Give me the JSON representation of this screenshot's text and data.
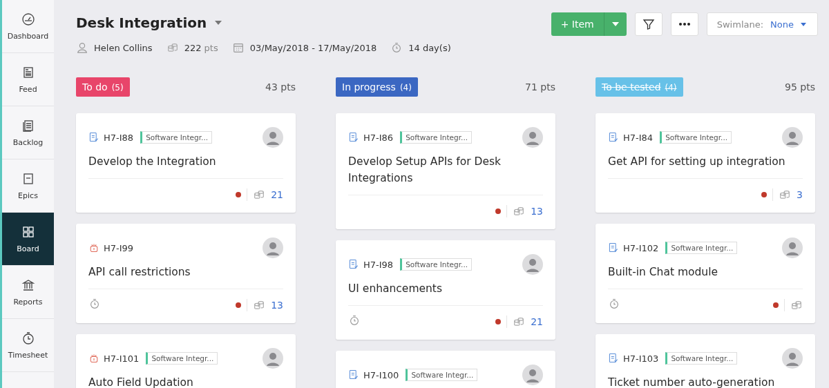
{
  "sidebar": {
    "items": [
      {
        "label": "Dashboard",
        "selected": false
      },
      {
        "label": "Feed",
        "selected": false
      },
      {
        "label": "Backlog",
        "selected": false
      },
      {
        "label": "Epics",
        "selected": false
      },
      {
        "label": "Board",
        "selected": true
      },
      {
        "label": "Reports",
        "selected": false
      },
      {
        "label": "Timesheet",
        "selected": false
      }
    ]
  },
  "header": {
    "title": "Desk Integration",
    "owner": "Helen Collins",
    "points": "222",
    "points_unit": "pts",
    "date_range": "03/May/2018 - 17/May/2018",
    "duration": "14 day(s)"
  },
  "toolbar": {
    "add_button": "+ Item",
    "swimlane_label": "Swimlane:",
    "swimlane_value": "None"
  },
  "columns": [
    {
      "title": "To do",
      "count": "(5)",
      "points": "43 pts",
      "color": "#e8456a",
      "strikethrough": false,
      "cards": [
        {
          "kind": "story",
          "id": "H7-I88",
          "tag": "Software Integr...",
          "title": "Develop the Integration",
          "timer": false,
          "points": "21"
        },
        {
          "kind": "bug",
          "id": "H7-I99",
          "title": "API call restrictions",
          "timer": true,
          "points": "13"
        },
        {
          "kind": "bug",
          "id": "H7-I101",
          "tag": "Software Integr...",
          "title": "Auto Field Updation"
        }
      ]
    },
    {
      "title": "In progress",
      "count": "(4)",
      "points": "71 pts",
      "color": "#3b67c2",
      "strikethrough": false,
      "cards": [
        {
          "kind": "story",
          "id": "H7-I86",
          "tag": "Software Integr...",
          "title": "Develop Setup APIs for Desk Integrations",
          "timer": false,
          "points": "13"
        },
        {
          "kind": "story",
          "id": "H7-I98",
          "tag": "Software Integr...",
          "title": "UI enhancements",
          "timer": true,
          "points": "21"
        },
        {
          "kind": "story",
          "id": "H7-I100",
          "tag": "Software Integr..."
        }
      ]
    },
    {
      "title": "To be tested",
      "count": "(4)",
      "points": "95 pts",
      "color": "#67c1e8",
      "strikethrough": true,
      "cards": [
        {
          "kind": "story",
          "id": "H7-I84",
          "tag": "Software Integr...",
          "title": "Get API for setting up integration",
          "timer": false,
          "points": "3"
        },
        {
          "kind": "story",
          "id": "H7-I102",
          "tag": "Software Integr...",
          "title": "Built-in Chat module",
          "timer": true
        },
        {
          "kind": "story",
          "id": "H7-I103",
          "tag": "Software Integr...",
          "title": "Ticket number auto-generation"
        }
      ]
    }
  ]
}
